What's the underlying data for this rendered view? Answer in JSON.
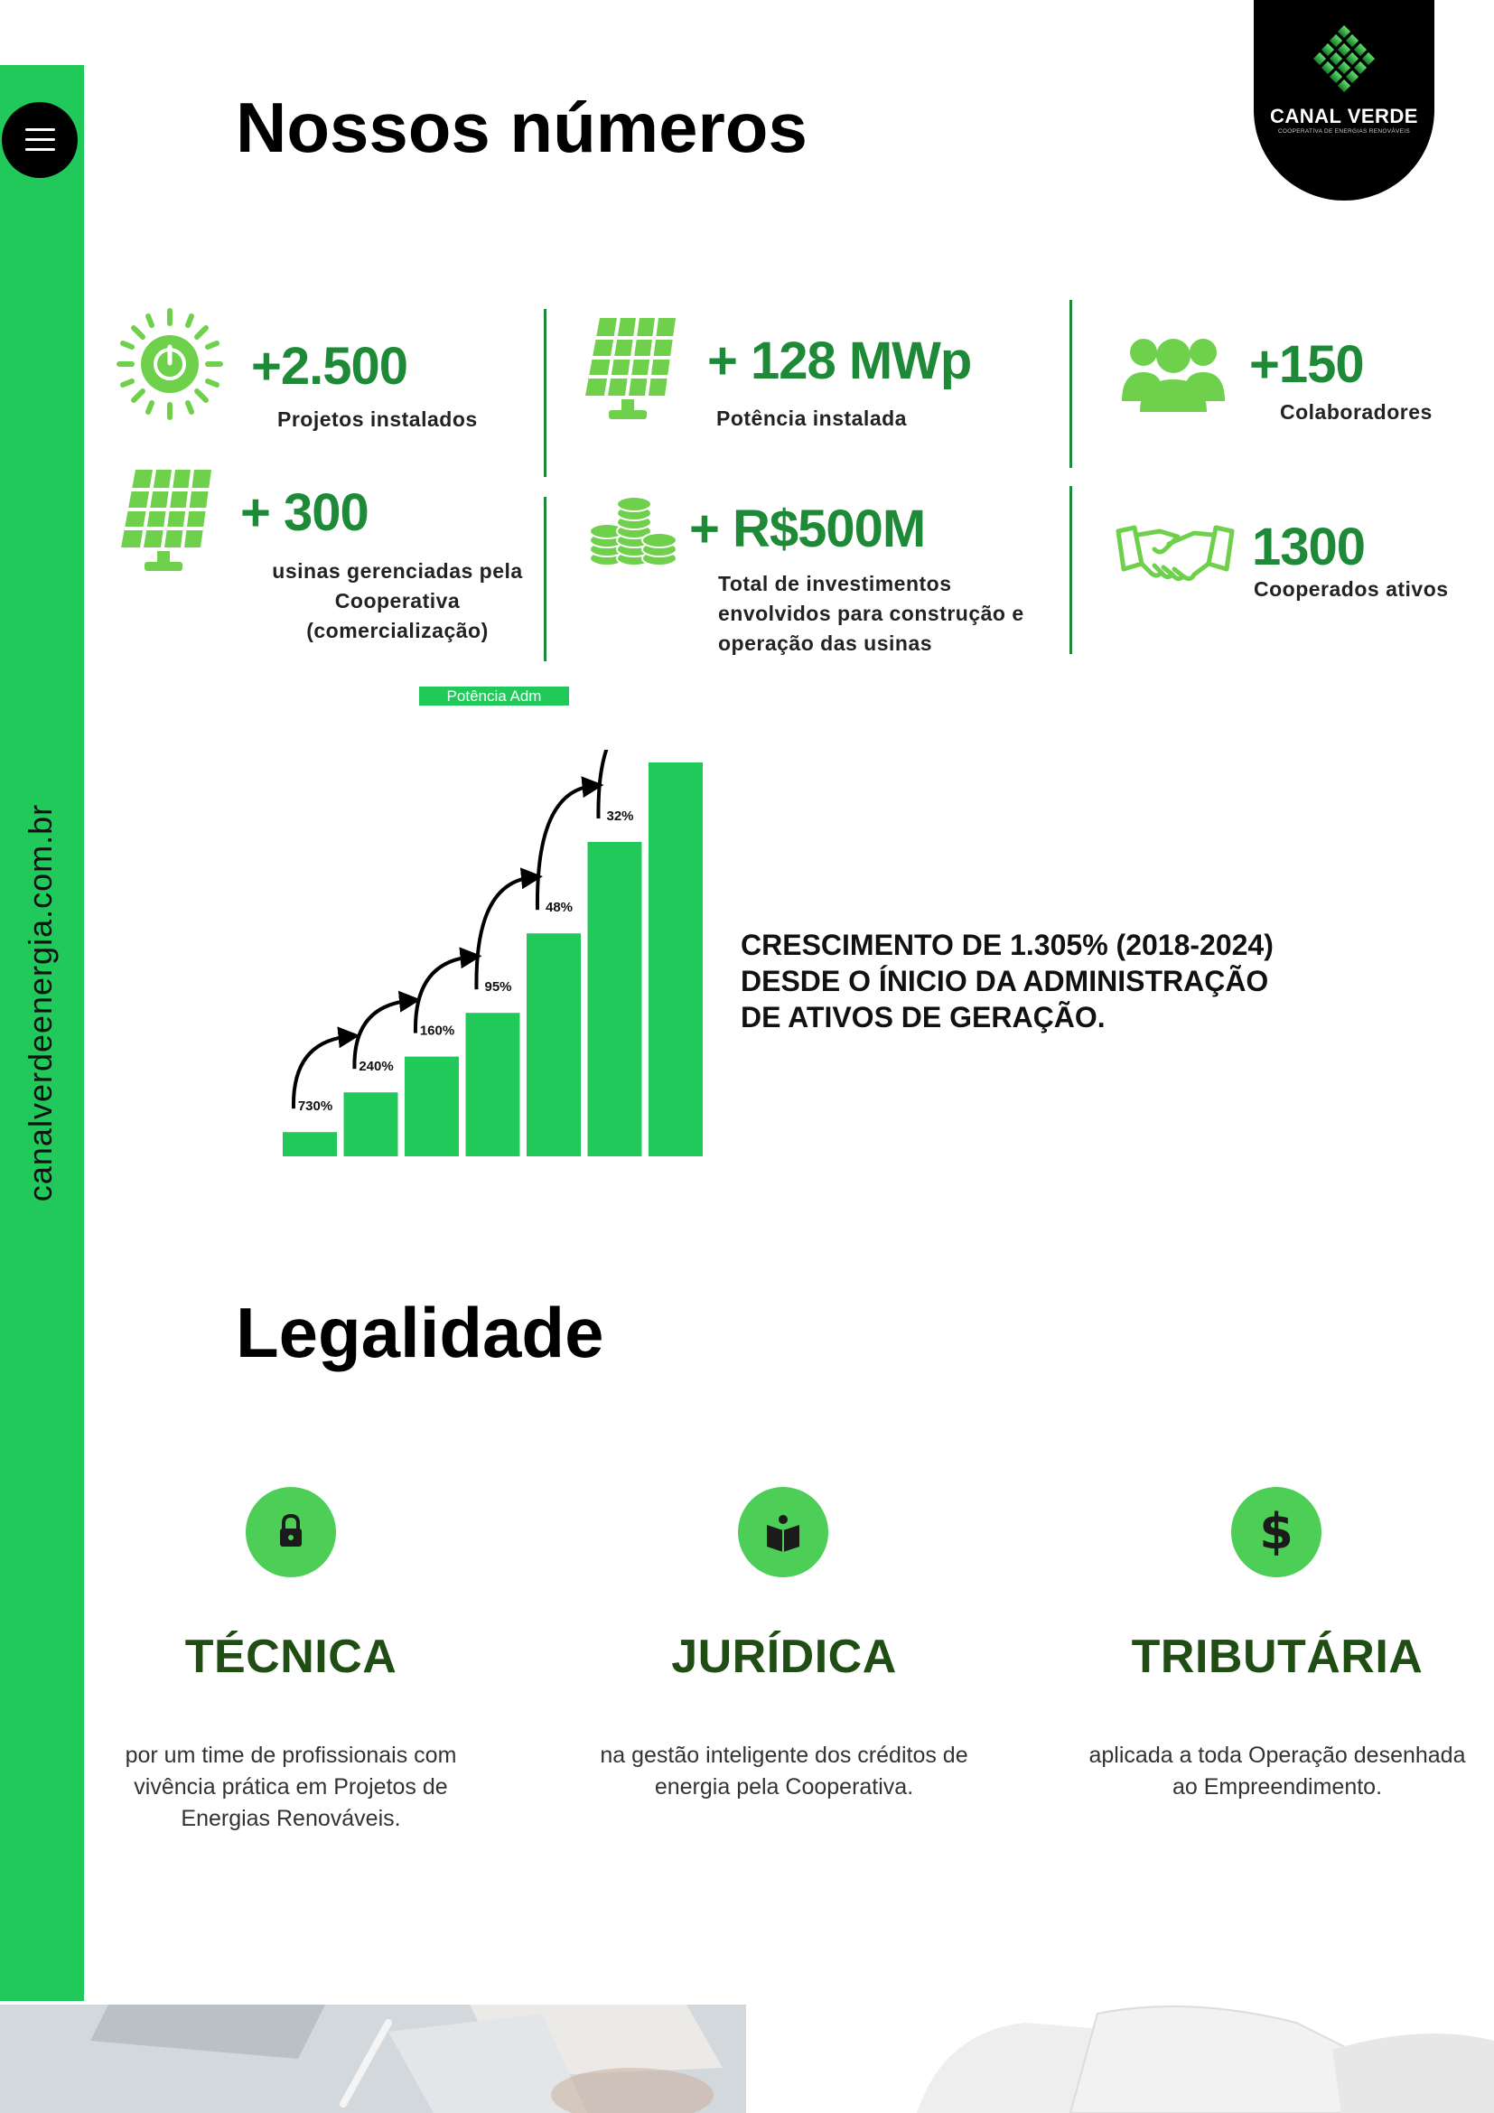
{
  "sidebar": {
    "url": "canalverdeenergia.com.br",
    "menu_icon": "hamburger-menu-icon"
  },
  "logo": {
    "name": "CANAL VERDE",
    "tagline": "COOPERATIVA DE ENERGIAS RENOVÁVEIS"
  },
  "numbers": {
    "title": "Nossos números",
    "stats": [
      {
        "icon": "sun-power-icon",
        "value": "+2.500",
        "label": "Projetos instalados"
      },
      {
        "icon": "solar-panel-icon",
        "value": "+ 128 MWp",
        "label": "Potência instalada"
      },
      {
        "icon": "people-group-icon",
        "value": "+150",
        "label": "Colaboradores"
      },
      {
        "icon": "solar-panel-icon",
        "value": "+ 300",
        "label": "usinas gerenciadas pela Cooperativa (comercialização)"
      },
      {
        "icon": "coin-stacks-icon",
        "value": "+ R$500M",
        "label": "Total de investimentos envolvidos para construção e operação das usinas"
      },
      {
        "icon": "handshake-icon",
        "value": "1300",
        "label": "Cooperados ativos"
      }
    ],
    "pill": "Potência Adm"
  },
  "chart_data": {
    "type": "bar",
    "title": "",
    "categories": [
      "1",
      "2",
      "3",
      "4",
      "5",
      "6",
      "7"
    ],
    "values": [
      0.07,
      0.17,
      0.26,
      0.37,
      0.57,
      0.8,
      1.0
    ],
    "growth_labels": [
      "730%",
      "240%",
      "160%",
      "95%",
      "48%",
      "32%"
    ],
    "color": "#20c95a"
  },
  "growth": {
    "line1": "CRESCIMENTO DE 1.305% (2018-2024)",
    "line2": "DESDE O ÍNICIO DA ADMINISTRAÇÃO",
    "line3": "DE ATIVOS DE GERAÇÃO."
  },
  "legal": {
    "title": "Legalidade",
    "items": [
      {
        "icon": "lock-icon",
        "title": "TÉCNICA",
        "desc": "por um time de profissionais com vivência prática em Projetos de Energias Renováveis."
      },
      {
        "icon": "book-icon",
        "title": "JURÍDICA",
        "desc": "na gestão inteligente dos créditos de energia pela Cooperativa."
      },
      {
        "icon": "dollar-icon",
        "title": "TRIBUTÁRIA",
        "desc": "aplicada a toda Operação desenhada ao Empreendimento."
      }
    ]
  },
  "colors": {
    "accent": "#20c95a",
    "dark_green": "#1e8a38",
    "icon_green": "#6fd04c",
    "legal_title": "#1f4d14"
  }
}
